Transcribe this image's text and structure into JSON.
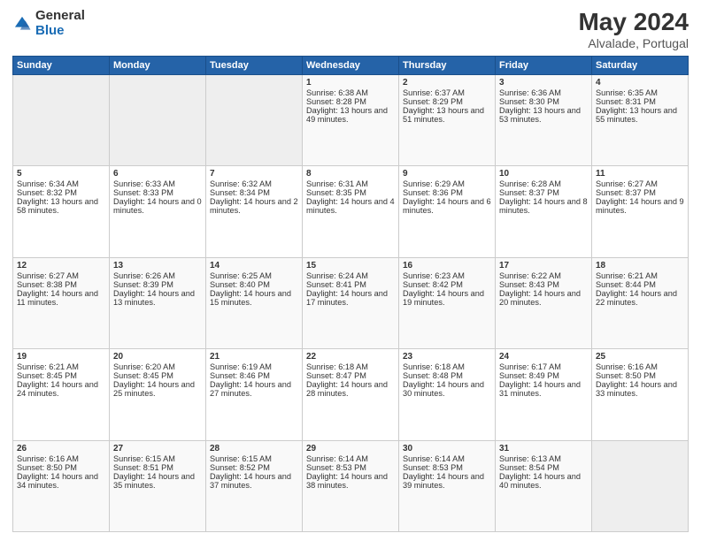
{
  "logo": {
    "general": "General",
    "blue": "Blue"
  },
  "title": "May 2024",
  "subtitle": "Alvalade, Portugal",
  "days_header": [
    "Sunday",
    "Monday",
    "Tuesday",
    "Wednesday",
    "Thursday",
    "Friday",
    "Saturday"
  ],
  "weeks": [
    [
      {
        "day": "",
        "empty": true
      },
      {
        "day": "",
        "empty": true
      },
      {
        "day": "",
        "empty": true
      },
      {
        "day": "1",
        "sunrise": "Sunrise: 6:38 AM",
        "sunset": "Sunset: 8:28 PM",
        "daylight": "Daylight: 13 hours and 49 minutes."
      },
      {
        "day": "2",
        "sunrise": "Sunrise: 6:37 AM",
        "sunset": "Sunset: 8:29 PM",
        "daylight": "Daylight: 13 hours and 51 minutes."
      },
      {
        "day": "3",
        "sunrise": "Sunrise: 6:36 AM",
        "sunset": "Sunset: 8:30 PM",
        "daylight": "Daylight: 13 hours and 53 minutes."
      },
      {
        "day": "4",
        "sunrise": "Sunrise: 6:35 AM",
        "sunset": "Sunset: 8:31 PM",
        "daylight": "Daylight: 13 hours and 55 minutes."
      }
    ],
    [
      {
        "day": "5",
        "sunrise": "Sunrise: 6:34 AM",
        "sunset": "Sunset: 8:32 PM",
        "daylight": "Daylight: 13 hours and 58 minutes."
      },
      {
        "day": "6",
        "sunrise": "Sunrise: 6:33 AM",
        "sunset": "Sunset: 8:33 PM",
        "daylight": "Daylight: 14 hours and 0 minutes."
      },
      {
        "day": "7",
        "sunrise": "Sunrise: 6:32 AM",
        "sunset": "Sunset: 8:34 PM",
        "daylight": "Daylight: 14 hours and 2 minutes."
      },
      {
        "day": "8",
        "sunrise": "Sunrise: 6:31 AM",
        "sunset": "Sunset: 8:35 PM",
        "daylight": "Daylight: 14 hours and 4 minutes."
      },
      {
        "day": "9",
        "sunrise": "Sunrise: 6:29 AM",
        "sunset": "Sunset: 8:36 PM",
        "daylight": "Daylight: 14 hours and 6 minutes."
      },
      {
        "day": "10",
        "sunrise": "Sunrise: 6:28 AM",
        "sunset": "Sunset: 8:37 PM",
        "daylight": "Daylight: 14 hours and 8 minutes."
      },
      {
        "day": "11",
        "sunrise": "Sunrise: 6:27 AM",
        "sunset": "Sunset: 8:37 PM",
        "daylight": "Daylight: 14 hours and 9 minutes."
      }
    ],
    [
      {
        "day": "12",
        "sunrise": "Sunrise: 6:27 AM",
        "sunset": "Sunset: 8:38 PM",
        "daylight": "Daylight: 14 hours and 11 minutes."
      },
      {
        "day": "13",
        "sunrise": "Sunrise: 6:26 AM",
        "sunset": "Sunset: 8:39 PM",
        "daylight": "Daylight: 14 hours and 13 minutes."
      },
      {
        "day": "14",
        "sunrise": "Sunrise: 6:25 AM",
        "sunset": "Sunset: 8:40 PM",
        "daylight": "Daylight: 14 hours and 15 minutes."
      },
      {
        "day": "15",
        "sunrise": "Sunrise: 6:24 AM",
        "sunset": "Sunset: 8:41 PM",
        "daylight": "Daylight: 14 hours and 17 minutes."
      },
      {
        "day": "16",
        "sunrise": "Sunrise: 6:23 AM",
        "sunset": "Sunset: 8:42 PM",
        "daylight": "Daylight: 14 hours and 19 minutes."
      },
      {
        "day": "17",
        "sunrise": "Sunrise: 6:22 AM",
        "sunset": "Sunset: 8:43 PM",
        "daylight": "Daylight: 14 hours and 20 minutes."
      },
      {
        "day": "18",
        "sunrise": "Sunrise: 6:21 AM",
        "sunset": "Sunset: 8:44 PM",
        "daylight": "Daylight: 14 hours and 22 minutes."
      }
    ],
    [
      {
        "day": "19",
        "sunrise": "Sunrise: 6:21 AM",
        "sunset": "Sunset: 8:45 PM",
        "daylight": "Daylight: 14 hours and 24 minutes."
      },
      {
        "day": "20",
        "sunrise": "Sunrise: 6:20 AM",
        "sunset": "Sunset: 8:45 PM",
        "daylight": "Daylight: 14 hours and 25 minutes."
      },
      {
        "day": "21",
        "sunrise": "Sunrise: 6:19 AM",
        "sunset": "Sunset: 8:46 PM",
        "daylight": "Daylight: 14 hours and 27 minutes."
      },
      {
        "day": "22",
        "sunrise": "Sunrise: 6:18 AM",
        "sunset": "Sunset: 8:47 PM",
        "daylight": "Daylight: 14 hours and 28 minutes."
      },
      {
        "day": "23",
        "sunrise": "Sunrise: 6:18 AM",
        "sunset": "Sunset: 8:48 PM",
        "daylight": "Daylight: 14 hours and 30 minutes."
      },
      {
        "day": "24",
        "sunrise": "Sunrise: 6:17 AM",
        "sunset": "Sunset: 8:49 PM",
        "daylight": "Daylight: 14 hours and 31 minutes."
      },
      {
        "day": "25",
        "sunrise": "Sunrise: 6:16 AM",
        "sunset": "Sunset: 8:50 PM",
        "daylight": "Daylight: 14 hours and 33 minutes."
      }
    ],
    [
      {
        "day": "26",
        "sunrise": "Sunrise: 6:16 AM",
        "sunset": "Sunset: 8:50 PM",
        "daylight": "Daylight: 14 hours and 34 minutes."
      },
      {
        "day": "27",
        "sunrise": "Sunrise: 6:15 AM",
        "sunset": "Sunset: 8:51 PM",
        "daylight": "Daylight: 14 hours and 35 minutes."
      },
      {
        "day": "28",
        "sunrise": "Sunrise: 6:15 AM",
        "sunset": "Sunset: 8:52 PM",
        "daylight": "Daylight: 14 hours and 37 minutes."
      },
      {
        "day": "29",
        "sunrise": "Sunrise: 6:14 AM",
        "sunset": "Sunset: 8:53 PM",
        "daylight": "Daylight: 14 hours and 38 minutes."
      },
      {
        "day": "30",
        "sunrise": "Sunrise: 6:14 AM",
        "sunset": "Sunset: 8:53 PM",
        "daylight": "Daylight: 14 hours and 39 minutes."
      },
      {
        "day": "31",
        "sunrise": "Sunrise: 6:13 AM",
        "sunset": "Sunset: 8:54 PM",
        "daylight": "Daylight: 14 hours and 40 minutes."
      },
      {
        "day": "",
        "empty": true
      }
    ]
  ]
}
